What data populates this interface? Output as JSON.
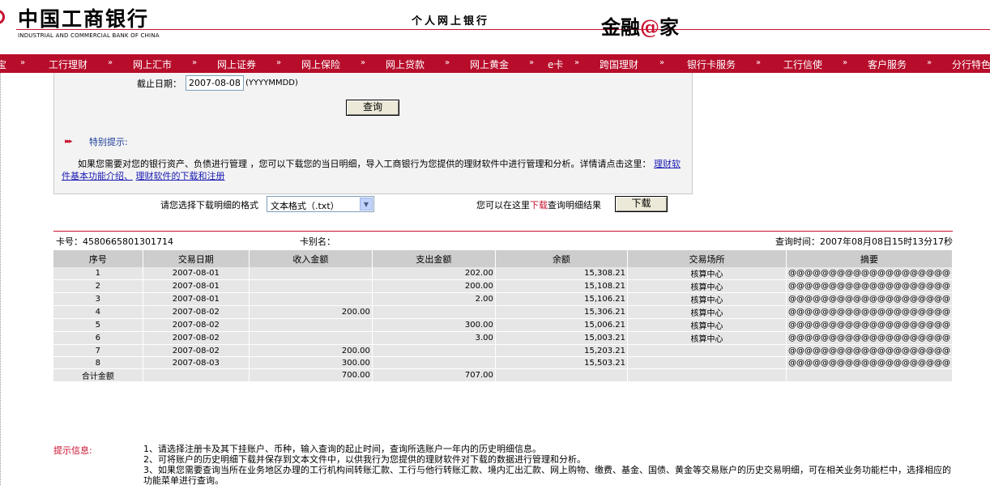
{
  "header": {
    "brand_cn": "中国工商银行",
    "brand_en": "INDUSTRIAL AND COMMERCIAL BANK OF CHINA",
    "tagline": "个人网上银行",
    "jinrong_a": "金融",
    "jinrong_at": "@",
    "jinrong_b": "家"
  },
  "nav": {
    "items": [
      "工行理财",
      "网上汇市",
      "网上证券",
      "网上保险",
      "网上贷款",
      "网上黄金",
      "e卡",
      "跨国理财",
      "银行卡服务",
      "工行信使",
      "客户服务",
      "分行特色"
    ],
    "separator": "»"
  },
  "query": {
    "end_date_label": "截止日期：",
    "end_date_value": "2007-08-08",
    "date_format_hint": "(YYYYMMDD)",
    "query_button": "查询"
  },
  "tip": {
    "arrow": "▸▸▸",
    "title": "特别提示:",
    "body": "如果您需要对您的银行资产、负债进行管理 ，您可以下载您的当日明细，导入工商银行为您提供的理财软件中进行管理和分析。详情请点击这里：",
    "link1": "理财软件基本功能介绍、",
    "link2": "理财软件的下载和注册"
  },
  "download": {
    "format_label": "请您选择下载明细的格式",
    "format_selected": "文本格式（.txt）",
    "hint_prefix": "您可以在这里",
    "hint_red": "下载",
    "hint_suffix": "查询明细结果",
    "button": "下载"
  },
  "result": {
    "card_no_label": "卡号：4580665801301714",
    "card_name_label": "卡别名：",
    "query_time": "查询时间：2007年08月08日15时13分17秒",
    "columns": [
      "序号",
      "交易日期",
      "收入金额",
      "支出金额",
      "余额",
      "交易场所",
      "摘要"
    ],
    "rows": [
      [
        "1",
        "2007-08-01",
        "",
        "202.00",
        "15,308.21",
        "核算中心",
        "@@@@@@@@@@@@@@@@@@@@"
      ],
      [
        "2",
        "2007-08-01",
        "",
        "200.00",
        "15,108.21",
        "核算中心",
        "@@@@@@@@@@@@@@@@@@@@"
      ],
      [
        "3",
        "2007-08-01",
        "",
        "2.00",
        "15,106.21",
        "核算中心",
        "@@@@@@@@@@@@@@@@@@@@"
      ],
      [
        "4",
        "2007-08-02",
        "200.00",
        "",
        "15,306.21",
        "核算中心",
        "@@@@@@@@@@@@@@@@@@@@"
      ],
      [
        "5",
        "2007-08-02",
        "",
        "300.00",
        "15,006.21",
        "核算中心",
        "@@@@@@@@@@@@@@@@@@@@"
      ],
      [
        "6",
        "2007-08-02",
        "",
        "3.00",
        "15,003.21",
        "核算中心",
        "@@@@@@@@@@@@@@@@@@@@"
      ],
      [
        "7",
        "2007-08-02",
        "200.00",
        "",
        "15,203.21",
        "",
        "@@@@@@@@@@@@@@@@@@@@"
      ],
      [
        "8",
        "2007-08-03",
        "300.00",
        "",
        "15,503.21",
        "",
        "@@@@@@@@@@@@@@@@@@@@"
      ]
    ],
    "total_label": "合计金额",
    "total_income": "700.00",
    "total_expense": "707.00"
  },
  "notes": {
    "label": "提示信息:",
    "items": [
      "1、请选择注册卡及其下挂账户、币种，输入查询的起止时间，查询所选账户一年内的历史明细信息。",
      "2、可将账户的历史明细下载并保存到文本文件中，以供我行为您提供的理财软件对下载的数据进行管理和分析。",
      "3、如果您需要查询当所在业务地区办理的工行机构间转账汇款、工行与他行转账汇款、境内汇出汇款、网上购物、缴费、基金、国债、黄金等交易账户的历史交易明细，可在相关业务功能栏中，选择相应的功能菜单进行查询。"
    ]
  },
  "colors": {
    "brand_red": "#b70d2a",
    "link_blue": "#1a1ab4",
    "table_header": "#cdcdcd",
    "table_row": "#e6e6e6"
  }
}
